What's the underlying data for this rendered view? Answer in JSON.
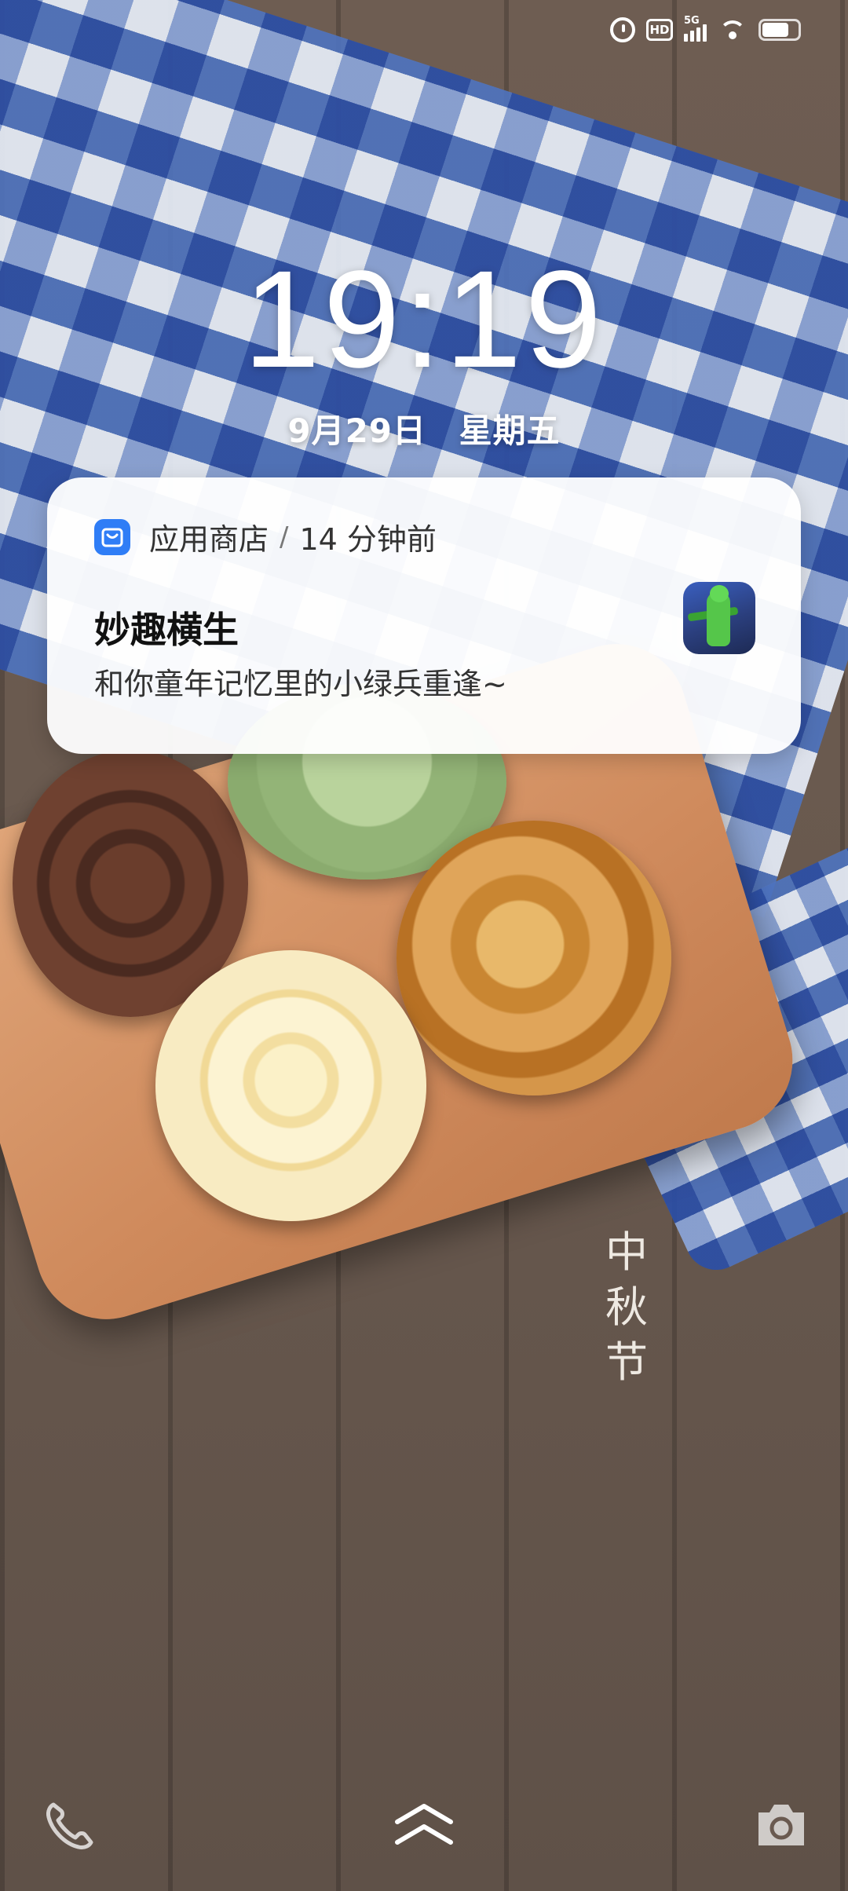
{
  "status_bar": {
    "network_label": "5G",
    "hd_label": "HD",
    "icons": [
      "alarm-icon",
      "hd-icon",
      "signal-5g-icon",
      "wifi-icon",
      "battery-icon"
    ],
    "battery_level": 0.75
  },
  "clock": {
    "time": "19:19"
  },
  "date": {
    "text": "9月29日 星期五"
  },
  "notification": {
    "app_name": "应用商店",
    "separator": "/",
    "time_ago": "14 分钟前",
    "title": "妙趣横生",
    "body": "和你童年记忆里的小绿兵重逢~",
    "app_icon_color": "#2f7df6"
  },
  "wallpaper": {
    "caption": "中秋节"
  },
  "bottom_bar": {
    "icons": [
      "phone-icon",
      "swipe-up-icon",
      "camera-icon"
    ]
  }
}
